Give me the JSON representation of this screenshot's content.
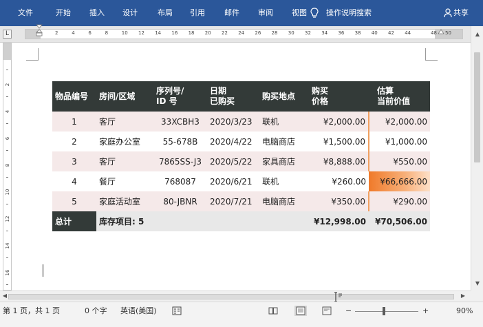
{
  "menu": {
    "file": "文件",
    "home": "开始",
    "insert": "插入",
    "design": "设计",
    "layout": "布局",
    "references": "引用",
    "mailings": "邮件",
    "review": "审阅",
    "view": "视图",
    "tell_me": "操作说明搜索",
    "share": "共享"
  },
  "ruler": {
    "tab_selector": "L",
    "h_numbers": [
      "2",
      "4",
      "6",
      "8",
      "10",
      "12",
      "14",
      "16",
      "18",
      "20",
      "22",
      "24",
      "26",
      "28",
      "30",
      "32",
      "34",
      "36",
      "38",
      "40",
      "42",
      "44",
      "48",
      "50"
    ],
    "v_numbers": [
      "2",
      "4",
      "6",
      "8",
      "10",
      "12",
      "14",
      "16",
      "18"
    ]
  },
  "table": {
    "headers": [
      "物品编号",
      "房间/区域",
      "序列号/\nID 号",
      "日期\n已购买",
      "购买地点",
      "购买\n价格",
      "估算\n当前价值"
    ],
    "rows": [
      [
        "1",
        "客厅",
        "33XCBH3",
        "2020/3/23",
        "联机",
        "¥2,000.00",
        "¥2,000.00"
      ],
      [
        "2",
        "家庭办公室",
        "55-678B",
        "2020/4/22",
        "电脑商店",
        "¥1,500.00",
        "¥1,000.00"
      ],
      [
        "3",
        "客厅",
        "7865SS-J3",
        "2020/5/22",
        "家具商店",
        "¥8,888.00",
        "¥550.00"
      ],
      [
        "4",
        "餐厅",
        "768087",
        "2020/6/21",
        "联机",
        "¥260.00",
        "¥66,666.00"
      ],
      [
        "5",
        "家庭活动室",
        "80-JBNR",
        "2020/7/21",
        "电脑商店",
        "¥350.00",
        "¥290.00"
      ]
    ],
    "total": {
      "label": "总计",
      "items": "库存项目: 5",
      "price": "¥12,998.00",
      "value": "¥70,506.00"
    }
  },
  "status": {
    "page": "第 1 页，共 1 页",
    "words": "0 个字",
    "language": "英语(美国)",
    "zoom": "90%",
    "zoom_minus": "−",
    "zoom_plus": "+"
  },
  "colors": {
    "ribbon": "#2b579a",
    "table_header": "#333a38",
    "odd_row": "#f5e9e9",
    "highlight": "#f07a2a"
  }
}
